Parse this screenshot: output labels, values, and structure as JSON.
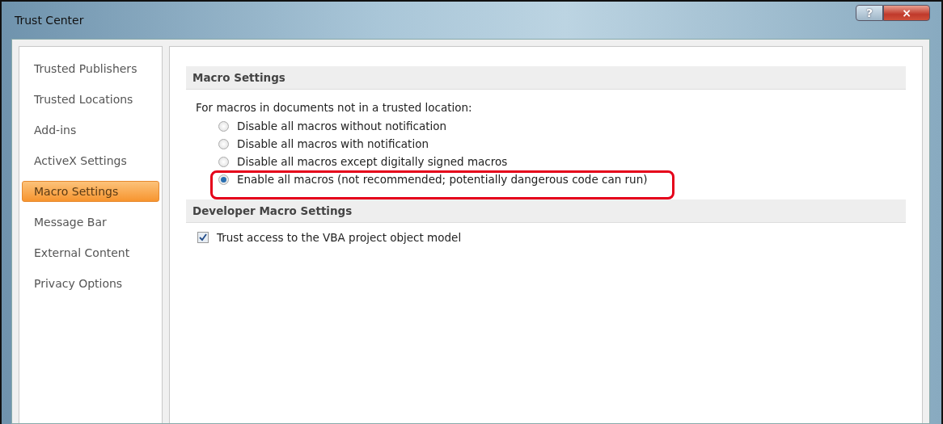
{
  "window": {
    "title": "Trust Center",
    "buttons": [
      "?",
      "×"
    ]
  },
  "sidebar": {
    "items": [
      {
        "label": "Trusted Publishers",
        "selected": false
      },
      {
        "label": "Trusted Locations",
        "selected": false
      },
      {
        "label": "Add-ins",
        "selected": false
      },
      {
        "label": "ActiveX Settings",
        "selected": false
      },
      {
        "label": "Macro Settings",
        "selected": true
      },
      {
        "label": "Message Bar",
        "selected": false
      },
      {
        "label": "External Content",
        "selected": false
      },
      {
        "label": "Privacy Options",
        "selected": false
      }
    ]
  },
  "macro_settings": {
    "heading": "Macro Settings",
    "intro": "For macros in documents not in a trusted location:",
    "options": [
      {
        "label": "Disable all macros without notification",
        "selected": false,
        "highlighted": false
      },
      {
        "label": "Disable all macros with notification",
        "selected": false,
        "highlighted": false
      },
      {
        "label": "Disable all macros except digitally signed macros",
        "selected": false,
        "highlighted": false
      },
      {
        "label": "Enable all macros (not recommended; potentially dangerous code can run)",
        "selected": true,
        "highlighted": true
      }
    ]
  },
  "developer_macro_settings": {
    "heading": "Developer Macro Settings",
    "options": [
      {
        "label": "Trust access to the VBA project object model",
        "checked": true
      }
    ]
  }
}
